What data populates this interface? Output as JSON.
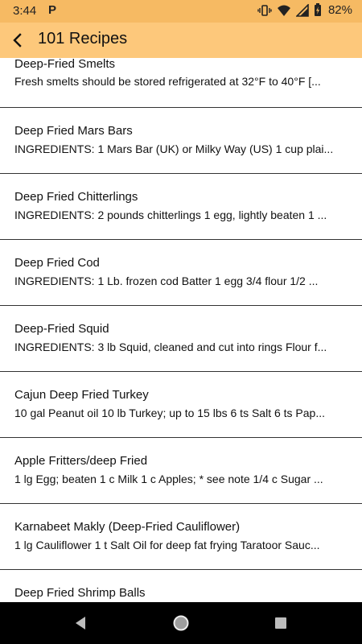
{
  "status_bar": {
    "time": "3:44",
    "battery_text": "82%"
  },
  "app_bar": {
    "title": "101 Recipes"
  },
  "recipes": [
    {
      "title": "Deep-Fried Smelts",
      "desc": "Fresh smelts should be stored refrigerated at 32°F to 40°F [..."
    },
    {
      "title": "Deep Fried Mars Bars",
      "desc": "INGREDIENTS: 1 Mars Bar (UK) or Milky Way (US) 1 cup plai..."
    },
    {
      "title": "Deep Fried Chitterlings",
      "desc": "INGREDIENTS: 2 pounds chitterlings 1 egg, lightly beaten 1 ..."
    },
    {
      "title": "Deep Fried Cod",
      "desc": "INGREDIENTS: 1 Lb.   frozen cod Batter 1 egg 3/4 flour 1/2  ..."
    },
    {
      "title": "Deep-Fried Squid",
      "desc": "INGREDIENTS:  3 lb Squid, cleaned and cut into rings Flour f..."
    },
    {
      "title": "Cajun Deep Fried Turkey",
      "desc": "10 gal Peanut oil 10 lb Turkey; up to 15 lbs 6 ts Salt 6 ts Pap..."
    },
    {
      "title": "Apple Fritters/deep Fried",
      "desc": "1 lg Egg; beaten 1 c Milk 1 c Apples; * see note 1/4 c Sugar ..."
    },
    {
      "title": "Karnabeet Makly (Deep-Fried Cauliflower)",
      "desc": "1 lg Cauliflower 1 t Salt Oil for deep fat frying Taratoor Sauc..."
    },
    {
      "title": "Deep Fried Shrimp Balls",
      "desc": ""
    }
  ]
}
